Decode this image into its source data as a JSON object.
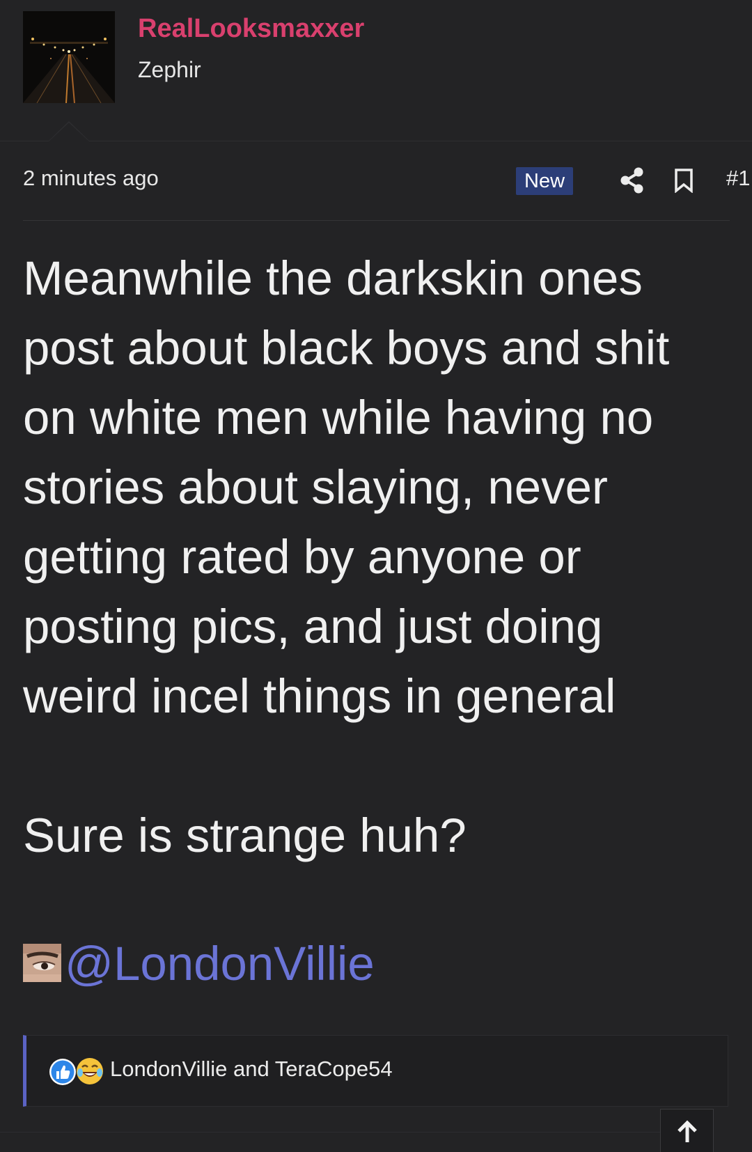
{
  "post": {
    "author": {
      "username": "RealLooksmaxxer",
      "title": "Zephir"
    },
    "meta": {
      "time": "2 minutes ago",
      "badge": "New",
      "number": "#1"
    },
    "body": {
      "paragraph1": "Meanwhile the darkskin ones post about black boys and shit on white men while having no stories about slaying, never getting rated by anyone or posting pics, and just doing weird incel things in general",
      "paragraph2": "Sure is strange huh?",
      "mention": "@LondonVillie"
    },
    "reactions": {
      "icons": [
        "like-icon",
        "laugh-icon"
      ],
      "users": "LondonVillie and TeraCope54"
    }
  },
  "icons": {
    "share": "share-icon",
    "bookmark": "bookmark-icon",
    "scroll_top": "arrow-up-icon"
  },
  "colors": {
    "background": "#232325",
    "username": "#d9406e",
    "badge_new": "#2c3e78",
    "mention": "#6b74d6",
    "reaction_accent": "#5b63c4"
  }
}
